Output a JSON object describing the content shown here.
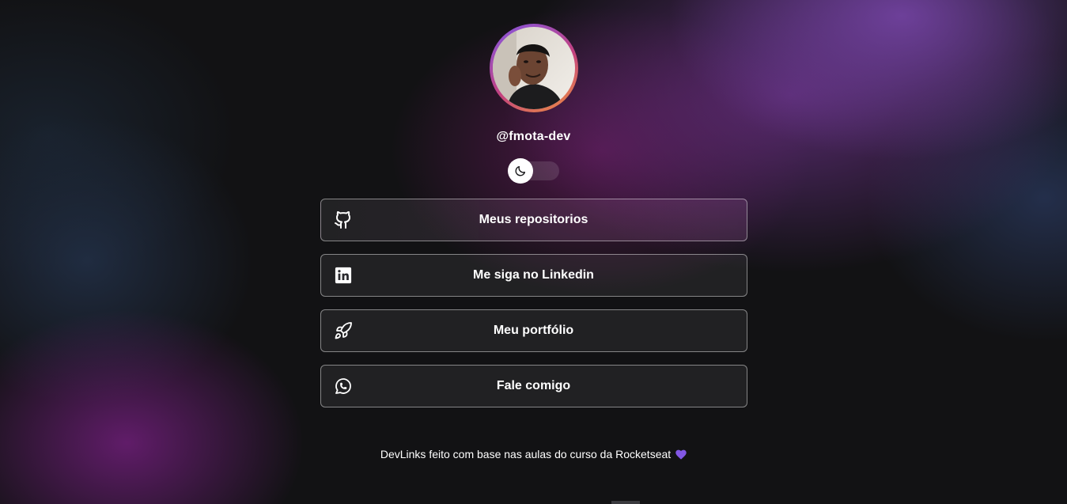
{
  "profile": {
    "username": "@fmota-dev",
    "avatar_alt": "",
    "ring_colors": [
      "#8257e5",
      "#c2417f",
      "#f0933c"
    ]
  },
  "theme_toggle": {
    "icon": "moon-icon",
    "state": "dark"
  },
  "links": [
    {
      "label": "Meus repositorios",
      "icon": "github-icon"
    },
    {
      "label": "Me siga no Linkedin",
      "icon": "linkedin-icon"
    },
    {
      "label": "Meu portfólio",
      "icon": "rocket-icon"
    },
    {
      "label": "Fale comigo",
      "icon": "whatsapp-icon"
    }
  ],
  "footer": {
    "text": "DevLinks feito com base nas aulas do curso da Rocketseat",
    "icon": "purple-heart-icon",
    "heart_color": "#8257e5"
  },
  "colors": {
    "background": "#121214",
    "text": "#ffffff",
    "button_border": "rgba(255,255,255,0.45)"
  }
}
